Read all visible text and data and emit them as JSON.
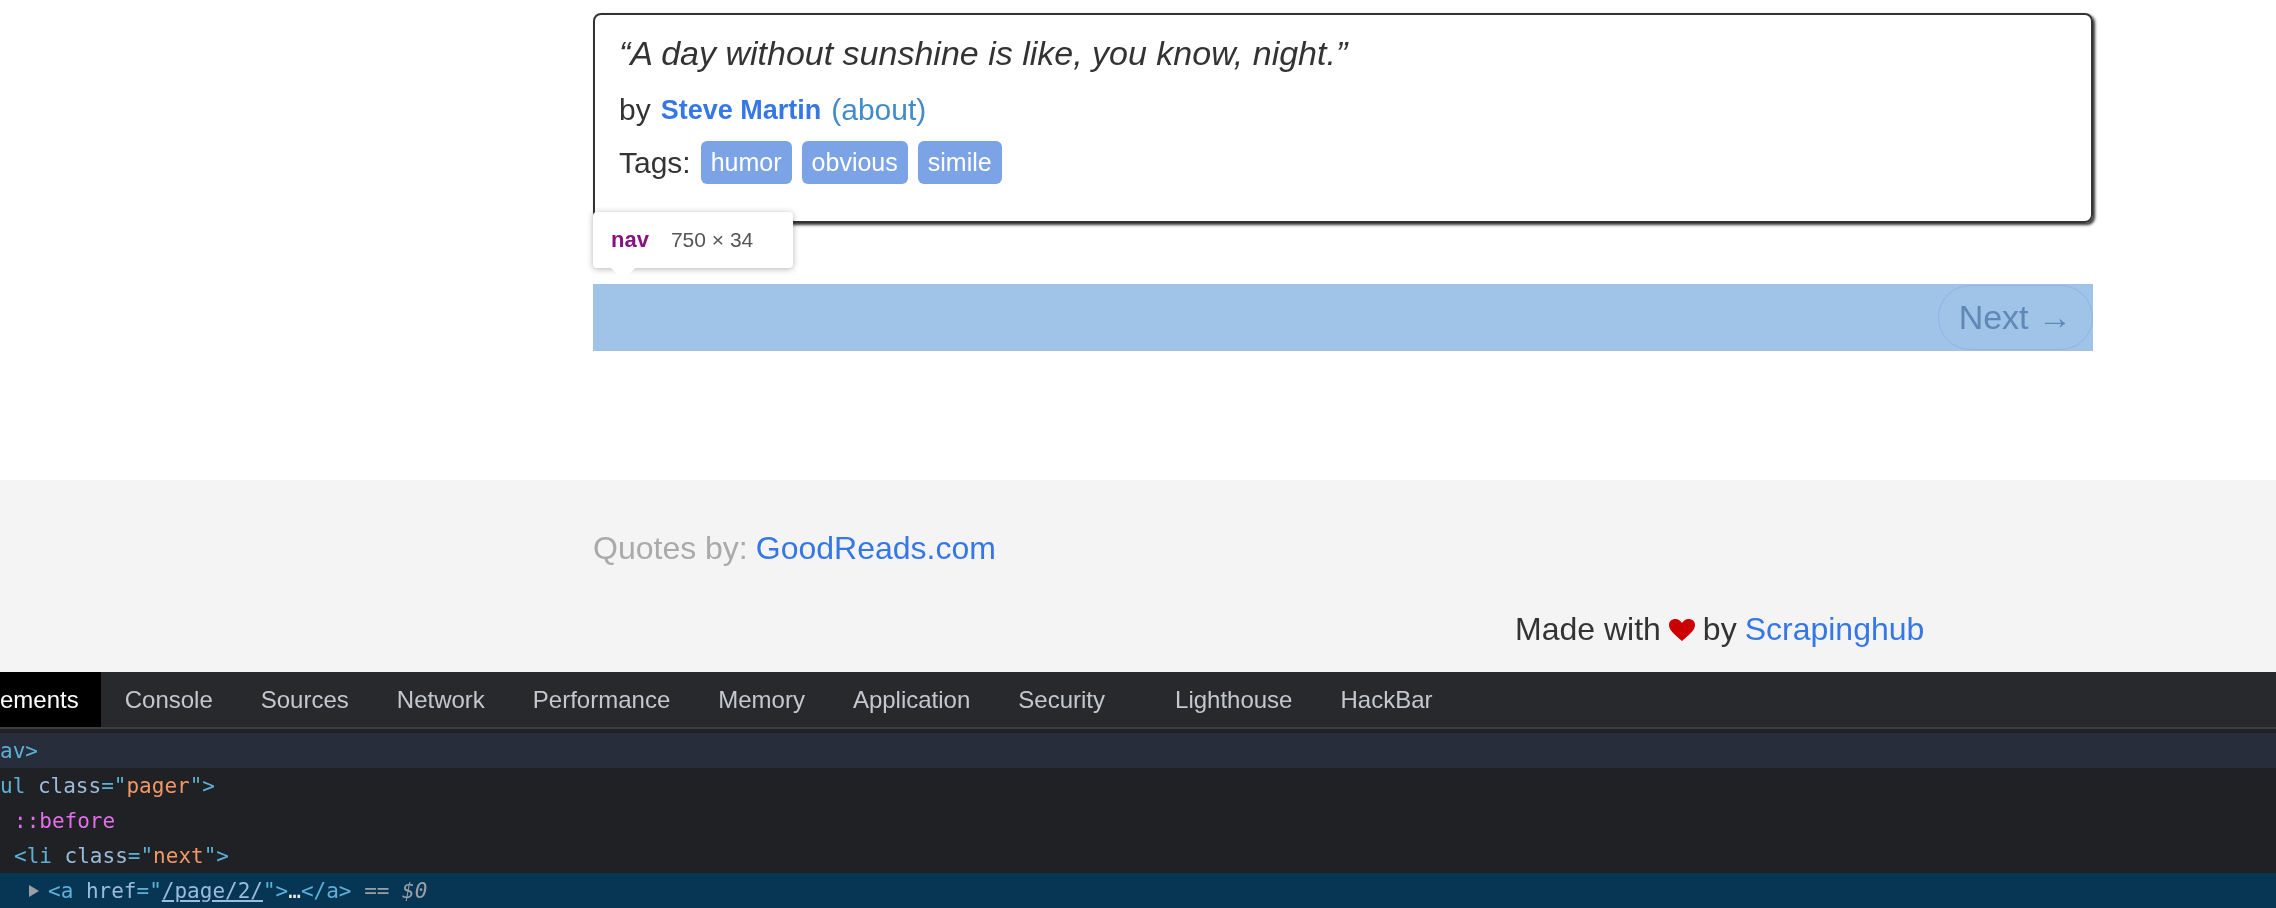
{
  "quote": {
    "text": "“A day without sunshine is like, you know, night.”",
    "by": "by",
    "author": "Steve Martin",
    "about": "(about)",
    "tags_label": "Tags:",
    "tags": [
      "humor",
      "obvious",
      "simile"
    ]
  },
  "inspector_tooltip": {
    "tag": "nav",
    "size": "750 × 34"
  },
  "pager": {
    "next": "Next →"
  },
  "footer": {
    "quotes_by": "Quotes by:",
    "source": "GoodReads.com",
    "made_with": "Made with",
    "by": "by",
    "maker": "Scrapinghub"
  },
  "devtools": {
    "tabs": [
      {
        "label": "ements",
        "selected": true
      },
      {
        "label": "Console",
        "selected": false
      },
      {
        "label": "Sources",
        "selected": false
      },
      {
        "label": "Network",
        "selected": false
      },
      {
        "label": "Performance",
        "selected": false
      },
      {
        "label": "Memory",
        "selected": false
      },
      {
        "label": "Application",
        "selected": false
      },
      {
        "label": "Security",
        "selected": false
      },
      {
        "label": "Lighthouse",
        "selected": false
      },
      {
        "label": "HackBar",
        "selected": false
      }
    ],
    "tree": [
      {
        "parts": [
          {
            "kind": "tag",
            "text": "av>"
          }
        ],
        "highlighted": true,
        "selected": false,
        "children": [
          {
            "parts": [
              {
                "kind": "tag",
                "text": "ul "
              },
              {
                "kind": "attr",
                "text": "class"
              },
              {
                "kind": "tag",
                "text": "=\""
              },
              {
                "kind": "value",
                "text": "pager"
              },
              {
                "kind": "tag",
                "text": "\">"
              }
            ],
            "highlighted": false,
            "selected": false,
            "children": [
              {
                "parts": [
                  {
                    "kind": "pseudo",
                    "text": "::before"
                  }
                ],
                "highlighted": false,
                "selected": false
              },
              {
                "parts": [
                  {
                    "kind": "tag",
                    "text": "<li "
                  },
                  {
                    "kind": "attr",
                    "text": "class"
                  },
                  {
                    "kind": "tag",
                    "text": "=\""
                  },
                  {
                    "kind": "value",
                    "text": "next"
                  },
                  {
                    "kind": "tag",
                    "text": "\">"
                  }
                ],
                "highlighted": false,
                "selected": false,
                "children": [
                  {
                    "collapsed": true,
                    "parts": [
                      {
                        "kind": "tag",
                        "text": "<a "
                      },
                      {
                        "kind": "attr",
                        "text": "href"
                      },
                      {
                        "kind": "tag",
                        "text": "=\""
                      },
                      {
                        "kind": "link",
                        "text": "/page/2/"
                      },
                      {
                        "kind": "tag",
                        "text": "\">"
                      },
                      {
                        "kind": "plain",
                        "text": "…"
                      },
                      {
                        "kind": "tag",
                        "text": "</a>"
                      },
                      {
                        "kind": "dim",
                        "text": " == "
                      },
                      {
                        "kind": "dimitalic",
                        "text": "$0"
                      }
                    ],
                    "highlighted": false,
                    "selected": true
                  }
                ]
              }
            ]
          }
        ]
      }
    ]
  }
}
